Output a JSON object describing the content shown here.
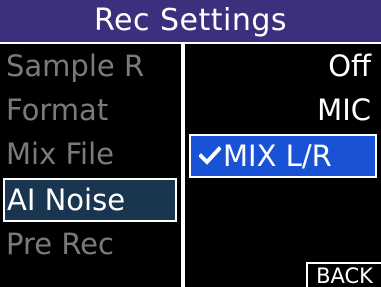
{
  "header": {
    "title": "Rec Settings"
  },
  "menu": {
    "items": [
      {
        "label": "Sample R"
      },
      {
        "label": "Format"
      },
      {
        "label": "Mix File"
      },
      {
        "label": "AI Noise"
      },
      {
        "label": "Pre Rec"
      }
    ],
    "selected_index": 3
  },
  "options": {
    "items": [
      {
        "label": "Off"
      },
      {
        "label": "MIC"
      },
      {
        "label": "MIX L/R"
      }
    ],
    "selected_index": 2
  },
  "footer": {
    "back_label": "BACK"
  },
  "colors": {
    "title_bg": "#3e2f7e",
    "selected_menu_bg": "#1a3550",
    "selected_option_bg": "#1a52d6",
    "inactive_text": "#7a7a7a",
    "active_text": "#ffffff"
  },
  "icons": {
    "selected_marker": "check-icon"
  }
}
